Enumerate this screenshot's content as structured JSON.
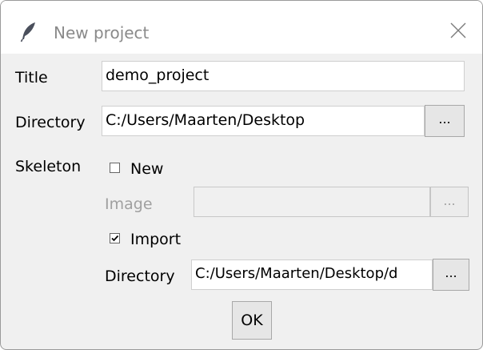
{
  "window": {
    "title": "New project"
  },
  "form": {
    "title_label": "Title",
    "title_value": "demo_project",
    "directory_label": "Directory",
    "directory_value": "C:/Users/Maarten/Desktop",
    "browse_label": "...",
    "skeleton_label": "Skeleton",
    "new_option": {
      "label": "New",
      "checked": false
    },
    "image_label": "Image",
    "image_value": "",
    "image_browse_label": "...",
    "import_option": {
      "label": "Import",
      "checked": true
    },
    "import_directory_label": "Directory",
    "import_directory_value": "C:/Users/Maarten/Desktop/d",
    "import_browse_label": "...",
    "ok_label": "OK"
  },
  "colors": {
    "title_text": "#8a8a8a",
    "dialog_background": "#f0f0f0",
    "disabled_text": "#a0a0a0",
    "icon": "#4a4f5c"
  },
  "icons": {
    "app": "feather-icon",
    "close": "close-icon",
    "checkbox_checked": "check-mark-icon"
  }
}
